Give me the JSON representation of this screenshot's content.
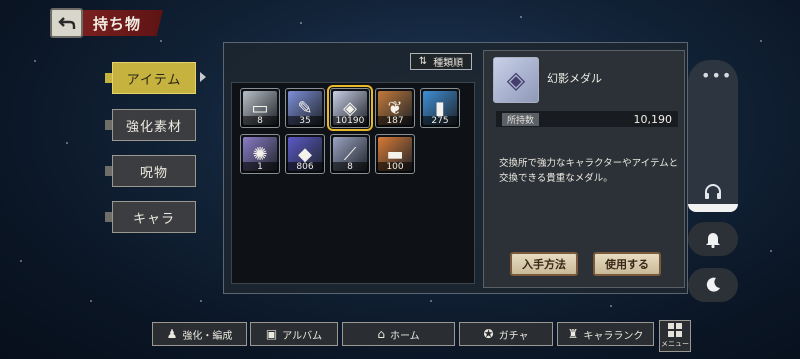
{
  "header": {
    "title": "持ち物"
  },
  "tabs": [
    "アイテム",
    "強化素材",
    "呪物",
    "キャラ"
  ],
  "sort_label": "種類順",
  "items": [
    {
      "count": "8",
      "color": "#b9bfc7",
      "icon": "ticket-icon",
      "glyph": "▭"
    },
    {
      "count": "35",
      "color": "#7d8fd8",
      "icon": "potion-icon",
      "glyph": "✎"
    },
    {
      "count": "10190",
      "color": "#c9d0e6",
      "icon": "medal-icon",
      "glyph": "◈"
    },
    {
      "count": "187",
      "color": "#c37a3a",
      "icon": "leaf-icon",
      "glyph": "❦"
    },
    {
      "count": "275",
      "color": "#3e8fd6",
      "icon": "vial-icon",
      "glyph": "▮"
    },
    {
      "count": "1",
      "color": "#8a7cc6",
      "icon": "compass-icon",
      "glyph": "✺"
    },
    {
      "count": "806",
      "color": "#5b59c8",
      "icon": "cloth-icon",
      "glyph": "◆"
    },
    {
      "count": "8",
      "color": "#9aa3c2",
      "icon": "blade-icon",
      "glyph": "⟋"
    },
    {
      "count": "100",
      "color": "#d97a35",
      "icon": "card-icon",
      "glyph": "▬"
    }
  ],
  "detail": {
    "name": "幻影メダル",
    "owned_label": "所持数",
    "owned_value": "10,190",
    "description": "交換所で強力なキャラクターやアイテムと交換できる貴重なメダル。",
    "obtain_button": "入手方法",
    "use_button": "使用する"
  },
  "nav": [
    "強化・編成",
    "アルバム",
    "ホーム",
    "ガチャ",
    "キャラランク"
  ],
  "menu_label": "メニュー"
}
